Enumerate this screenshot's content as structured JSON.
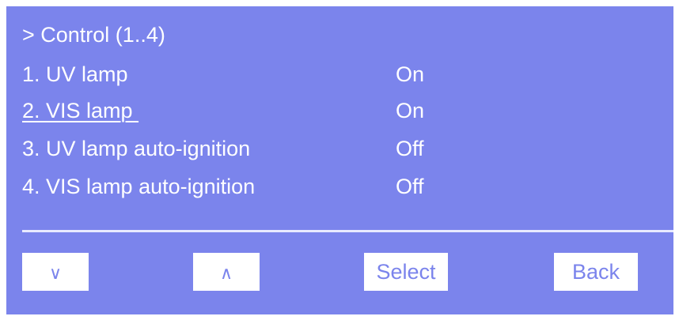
{
  "menu": {
    "header": "> Control (1..4)",
    "items": [
      {
        "label": "1. UV lamp",
        "value": "On"
      },
      {
        "label": "2. VIS lamp ",
        "value": "On"
      },
      {
        "label": "3. UV lamp auto-ignition",
        "value": "Off"
      },
      {
        "label": "4. VIS lamp auto-ignition",
        "value": "Off"
      }
    ],
    "selected_index": 1
  },
  "buttons": {
    "down_glyph": "∨",
    "up_glyph": "∧",
    "select_label": "Select",
    "back_label": "Back"
  },
  "colors": {
    "screen_bg": "#7b84ec",
    "text": "#ffffff",
    "button_bg": "#ffffff",
    "button_text": "#7b84ec"
  }
}
